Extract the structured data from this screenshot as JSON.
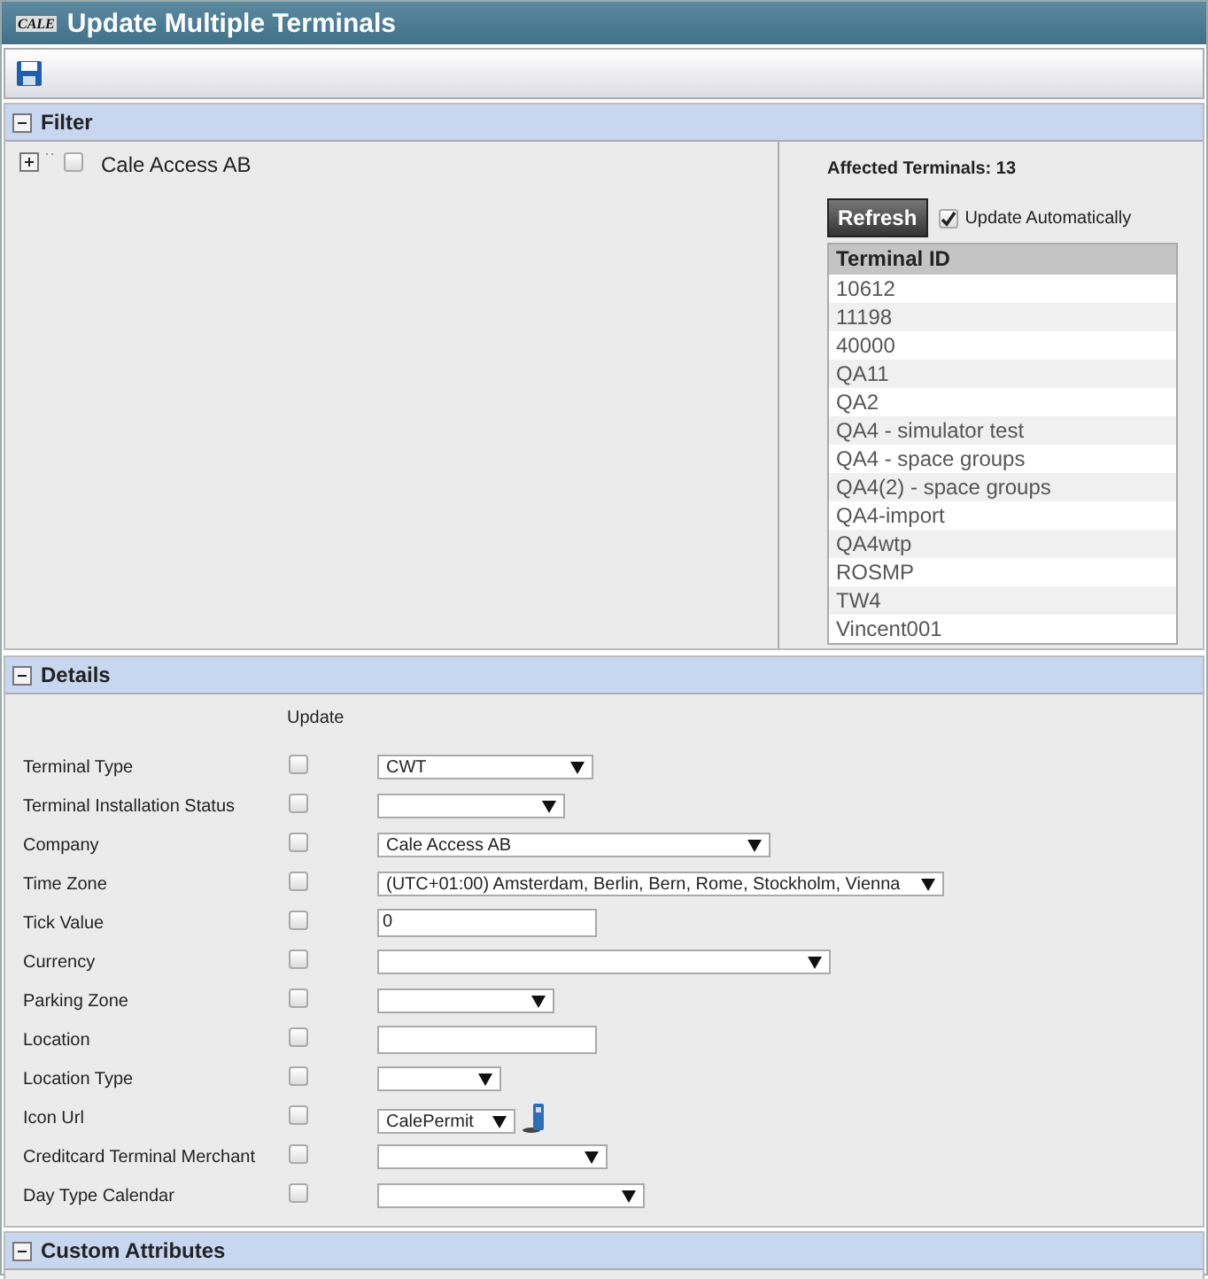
{
  "window": {
    "logo": "CALE",
    "title": "Update Multiple Terminals"
  },
  "filter": {
    "title": "Filter",
    "expanded": true,
    "tree": [
      {
        "label": "Cale Access AB",
        "expanded": false,
        "checked": false
      }
    ],
    "affected_label": "Affected Terminals: 13",
    "refresh_button": "Refresh",
    "auto_update": {
      "label": "Update Automatically",
      "checked": true
    },
    "terminals": {
      "column": "Terminal ID",
      "rows": [
        "10612",
        "11198",
        "40000",
        "QA11",
        "QA2",
        "QA4 - simulator test",
        "QA4 - space groups",
        "QA4(2) - space groups",
        "QA4-import",
        "QA4wtp",
        "ROSMP",
        "TW4",
        "Vincent001"
      ]
    }
  },
  "details": {
    "title": "Details",
    "expanded": true,
    "update_header": "Update",
    "fields": [
      {
        "label": "Terminal Type",
        "update": false,
        "kind": "select",
        "value": "CWT"
      },
      {
        "label": "Terminal Installation Status",
        "update": false,
        "kind": "select"
      },
      {
        "label": "Company",
        "update": false,
        "kind": "select",
        "value": "Cale Access AB"
      },
      {
        "label": "Time Zone",
        "update": false,
        "kind": "select",
        "value": "(UTC+01:00) Amsterdam, Berlin, Bern, Rome, Stockholm, Vienna"
      },
      {
        "label": "Tick Value",
        "update": false,
        "kind": "text",
        "value": "0"
      },
      {
        "label": "Currency",
        "update": false,
        "kind": "select"
      },
      {
        "label": "Parking Zone",
        "update": false,
        "kind": "select"
      },
      {
        "label": "Location",
        "update": false,
        "kind": "text"
      },
      {
        "label": "Location Type",
        "update": false,
        "kind": "select"
      },
      {
        "label": "Icon Url",
        "update": false,
        "kind": "icon-select",
        "value": "CalePermit"
      },
      {
        "label": "Creditcard Terminal Merchant",
        "update": false,
        "kind": "select"
      },
      {
        "label": "Day Type Calendar",
        "update": false,
        "kind": "select"
      }
    ]
  },
  "custom_attributes": {
    "title": "Custom Attributes",
    "expanded": true
  }
}
